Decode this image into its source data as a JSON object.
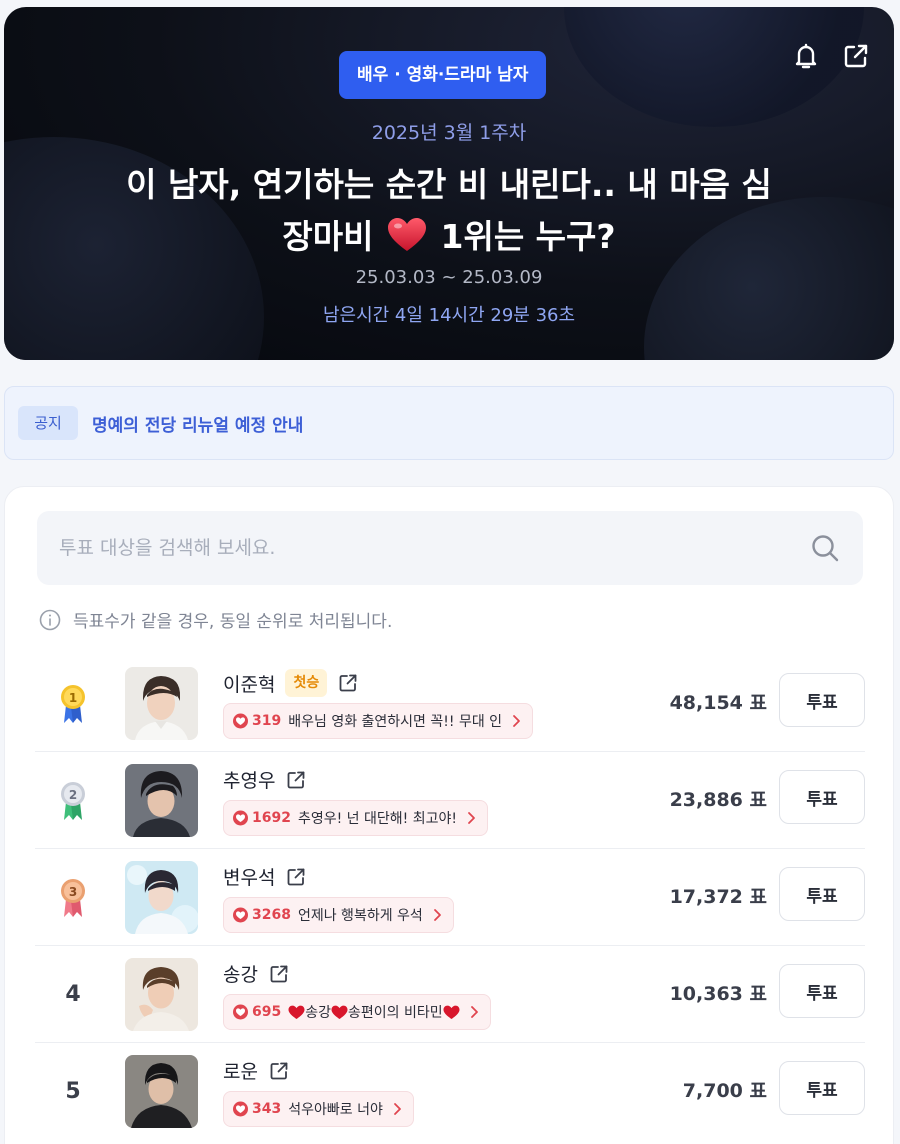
{
  "hero": {
    "category": "배우 · 영화·드라마 남자",
    "week": "2025년 3월 1주차",
    "title_line1": "이 남자, 연기하는 순간 비 내린다.. 내 마음 심",
    "title_line2a": "장마비",
    "title_line2b": "1위는 누구?",
    "period": "25.03.03 ~ 25.03.09",
    "remaining": "남은시간 4일 14시간 29분 36초",
    "icons": {
      "notify": "bell-icon",
      "share": "share-icon"
    }
  },
  "notice": {
    "tag": "공지",
    "text": "명예의 전당 리뉴얼 예정 안내"
  },
  "search": {
    "placeholder": "투표 대상을 검색해 보세요."
  },
  "info_text": "득표수가 같을 경우, 동일 순위로 처리됩니다.",
  "vote_label": "투표",
  "colors": {
    "accent": "#2f5ef0",
    "heart": "#e0454f",
    "badge": "#e58a06"
  },
  "candidates": [
    {
      "rank": "1",
      "name": "이준혁",
      "badge": "첫승",
      "hearts": "319",
      "message": "배우님 영화 출연하시면 꼭!! 무대 인",
      "votes": "48,154 표"
    },
    {
      "rank": "2",
      "name": "추영우",
      "hearts": "1692",
      "message": "추영우! 넌 대단해! 최고야!",
      "votes": "23,886 표"
    },
    {
      "rank": "3",
      "name": "변우석",
      "hearts": "3268",
      "message": "언제나 행복하게 우석",
      "votes": "17,372 표"
    },
    {
      "rank": "4",
      "name": "송강",
      "hearts": "695",
      "message_a": "송강",
      "message_b": "송편이의 비타민",
      "votes": "10,363 표"
    },
    {
      "rank": "5",
      "name": "로운",
      "hearts": "343",
      "message": "석우아빠로 너야",
      "votes": "7,700 표"
    }
  ]
}
